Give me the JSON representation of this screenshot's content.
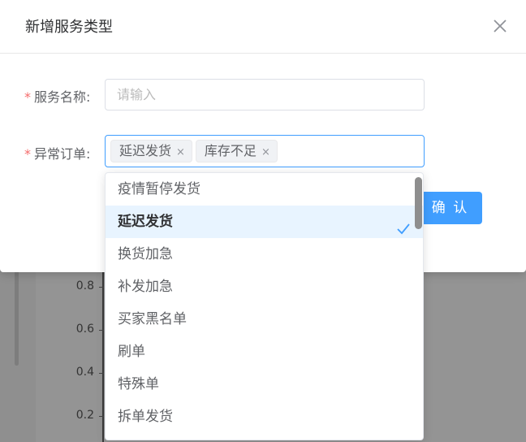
{
  "background": {
    "y_ticks": [
      "0.8",
      "0.6",
      "0.4",
      "0.2"
    ]
  },
  "dialog": {
    "title": "新增服务类型",
    "close_icon": "close-icon"
  },
  "form": {
    "name_field": {
      "required_mark": "*",
      "label": "服务名称:",
      "placeholder": "请输入",
      "value": ""
    },
    "abnormal_field": {
      "required_mark": "*",
      "label": "异常订单:",
      "tags": [
        {
          "label": "延迟发货",
          "remove": "×"
        },
        {
          "label": "库存不足",
          "remove": "×"
        }
      ]
    }
  },
  "confirm_button": "确 认",
  "dropdown": {
    "options": [
      "疫情暂停发货",
      "延迟发货",
      "换货加急",
      "补发加急",
      "买家黑名单",
      "刷单",
      "特殊单",
      "拆单发货"
    ],
    "selected": "延迟发货",
    "check_icon": "check-icon"
  },
  "colors": {
    "primary": "#409eff",
    "required": "#f56c6c",
    "overlay": "#8f8f8f",
    "selected_bg": "#e8f4ff"
  }
}
